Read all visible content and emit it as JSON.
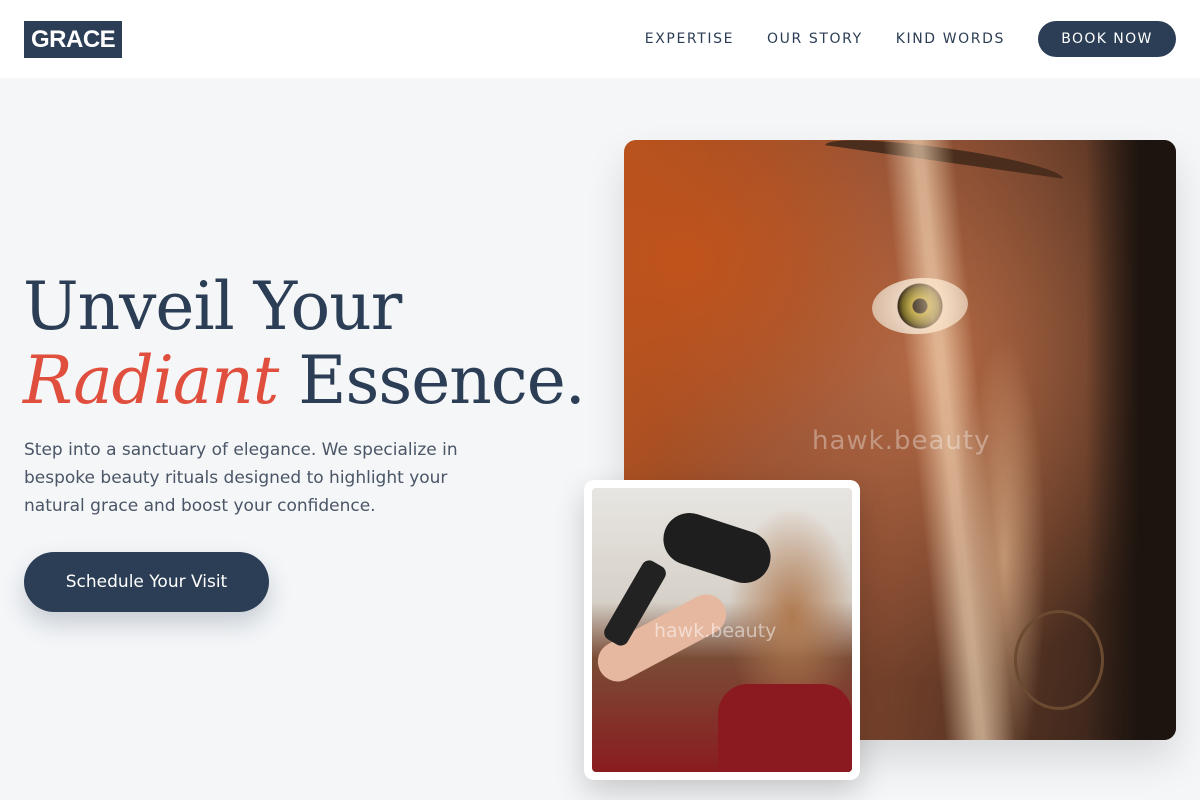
{
  "header": {
    "logo": "GRACE",
    "nav": [
      {
        "label": "EXPERTISE"
      },
      {
        "label": "OUR STORY"
      },
      {
        "label": "KIND WORDS"
      }
    ],
    "book_label": "BOOK NOW"
  },
  "hero": {
    "headline_line1": "Unveil Your",
    "headline_accent": "Radiant",
    "headline_rest": " Essence.",
    "lede": "Step into a sanctuary of elegance. We specialize in bespoke beauty rituals designed to highlight your natural grace and boost your confidence.",
    "cta_label": "Schedule Your Visit"
  },
  "media": {
    "main_watermark": "hawk.beauty",
    "small_watermark": "hawk.beauty"
  },
  "colors": {
    "brand": "#2c3e55",
    "accent": "#e04f3d",
    "background": "#f4f6f8"
  }
}
